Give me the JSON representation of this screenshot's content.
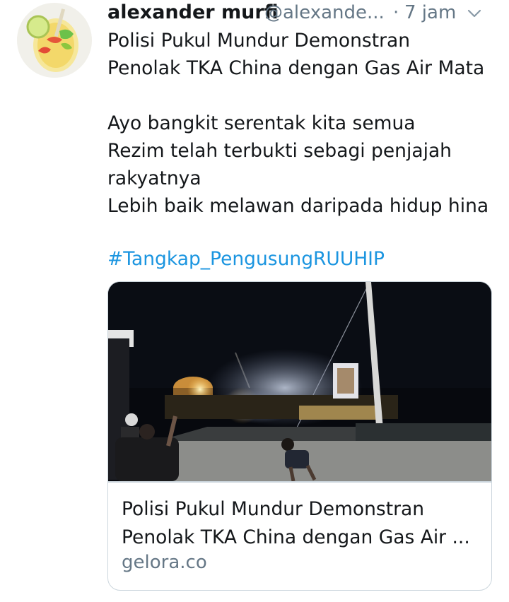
{
  "tweet": {
    "author": {
      "display_name": "alexander murfi",
      "handle": "@alexande...",
      "avatar_icon": "fruit-drink-avatar"
    },
    "separator": "·",
    "timestamp": "7 jam",
    "menu_icon": "chevron-down-icon",
    "text_lines": [
      "Polisi Pukul Mundur Demonstran",
      "Penolak TKA China dengan Gas Air Mata",
      "",
      "Ayo bangkit serentak kita semua",
      "Rezim telah terbukti sebagi penjajah",
      "rakyatnya",
      "Lebih baik melawan daripada hidup hina"
    ],
    "hashtag": "#Tangkap_PengusungRUUHIP"
  },
  "card": {
    "image_description_icon": "night-protest-photo",
    "title_lines": [
      "Polisi Pukul Mundur Demonstran",
      "Penolak TKA China dengan Gas Air ..."
    ],
    "domain": "gelora.co"
  },
  "colors": {
    "text": "#14171a",
    "secondary": "#657786",
    "link": "#1b95e0",
    "border": "#ccd6dd"
  }
}
